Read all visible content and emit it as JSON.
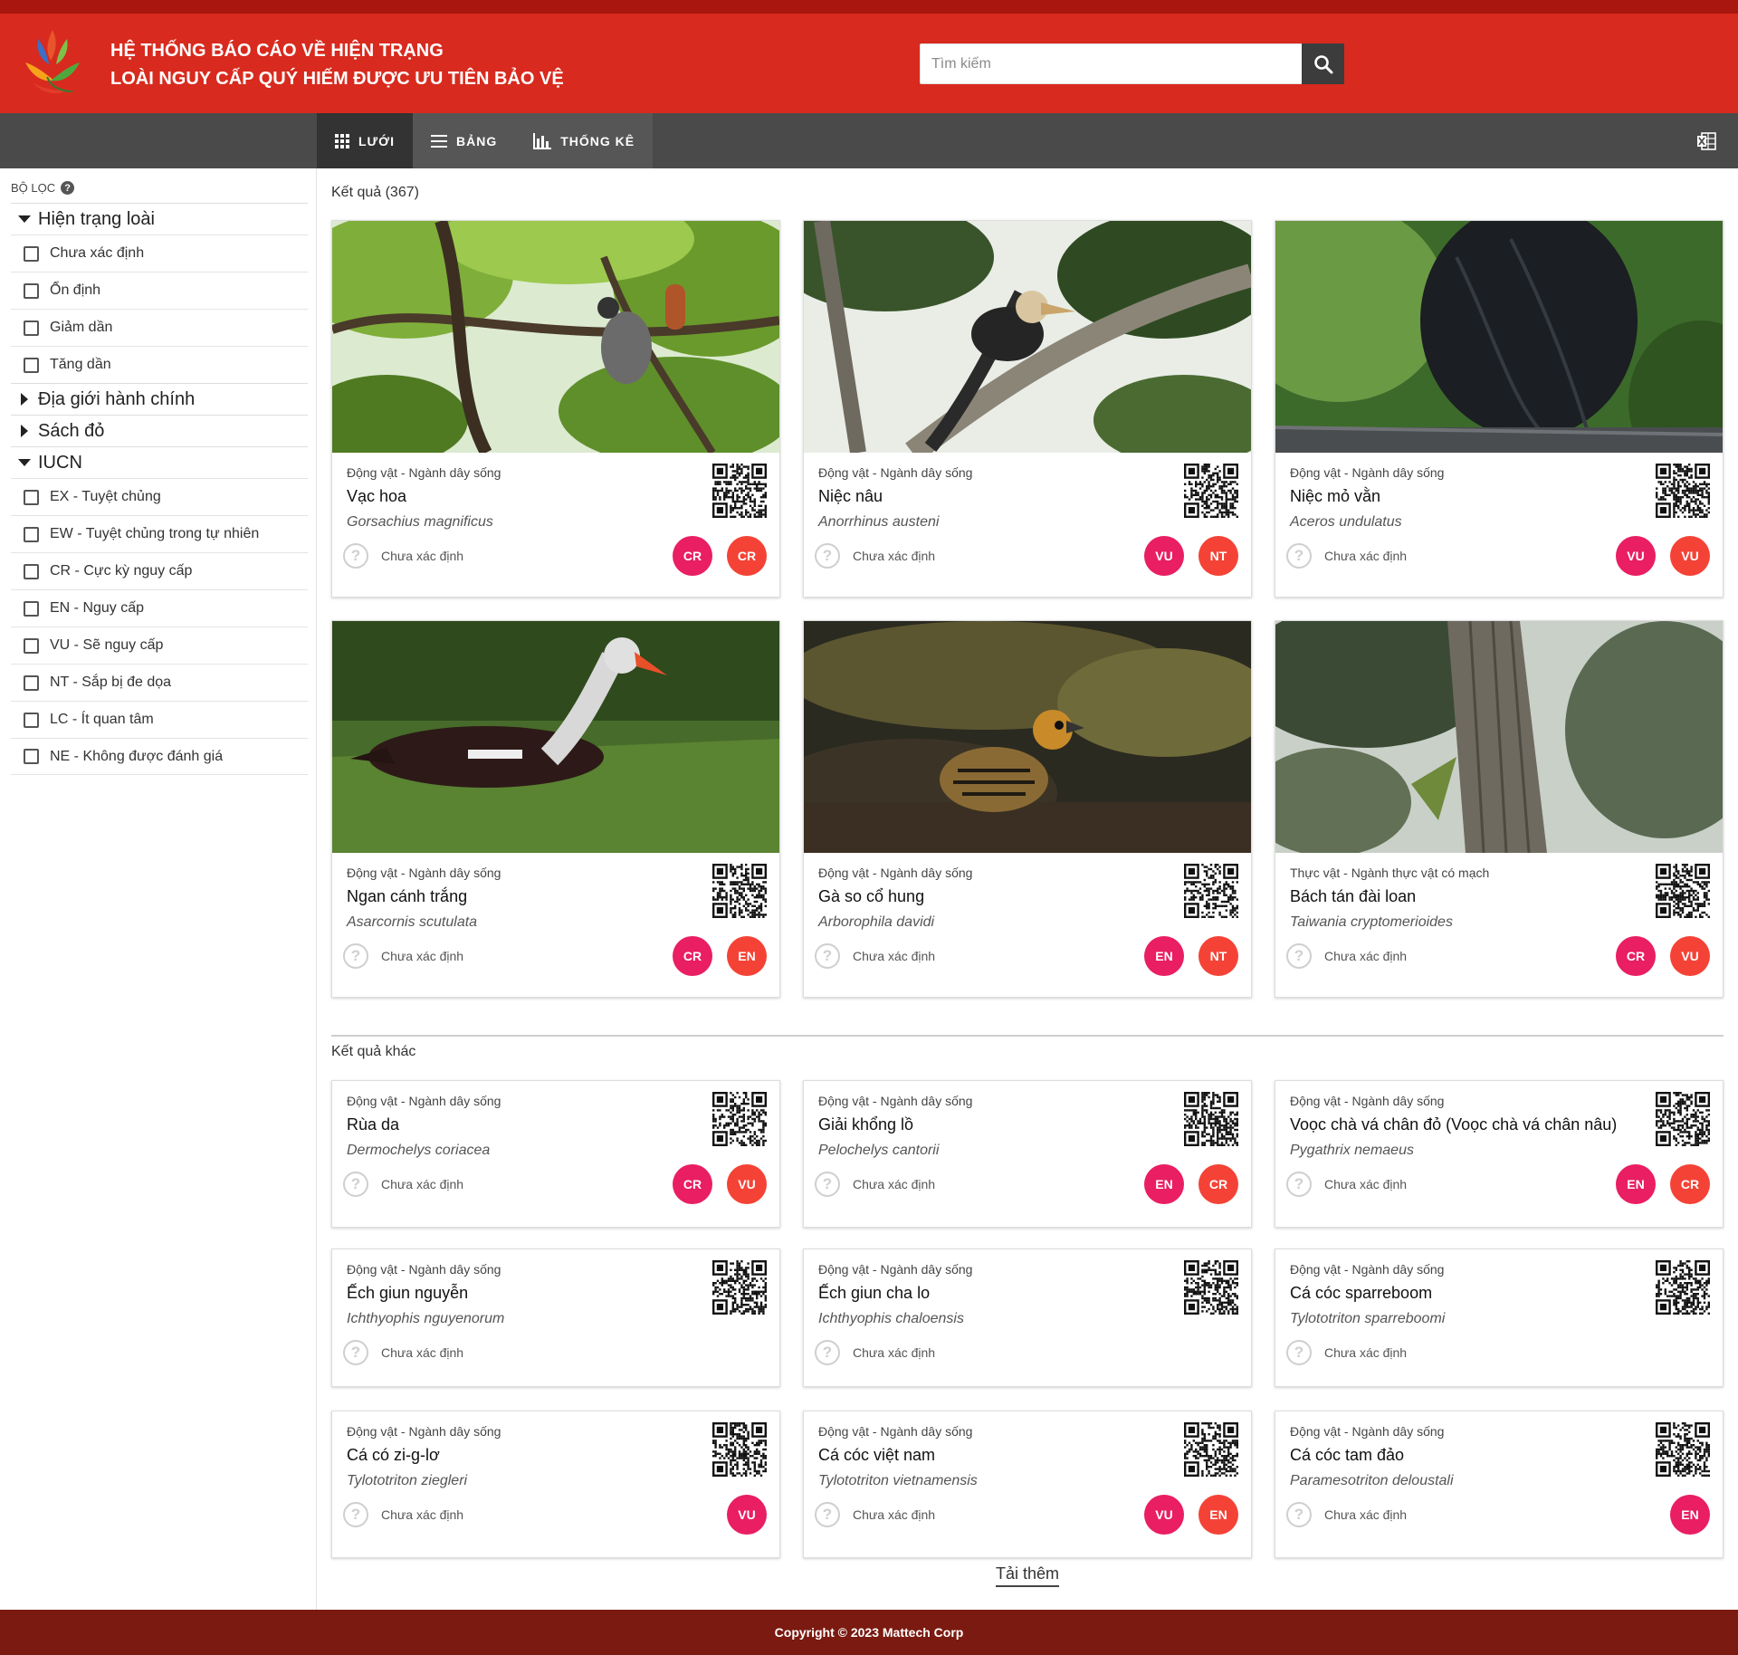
{
  "header": {
    "title_line1": "HỆ THỐNG BÁO CÁO VỀ HIỆN TRẠNG",
    "title_line2": "LOÀI NGUY CẤP QUÝ HIẾM ĐƯỢC ƯU TIÊN BẢO VỆ",
    "search_placeholder": "Tìm kiếm",
    "search_icon": "search-icon"
  },
  "toolbar": {
    "tabs": [
      {
        "label": "LƯỚI",
        "icon": "grid-icon",
        "active": true
      },
      {
        "label": "BẢNG",
        "icon": "list-icon",
        "active": false
      },
      {
        "label": "THỐNG KÊ",
        "icon": "bar-chart-icon",
        "active": false
      }
    ],
    "excel_icon": "excel-export-icon"
  },
  "sidebar": {
    "filter_label": "BỘ LỌC",
    "sections": [
      {
        "title": "Hiện trạng loài",
        "expanded": true,
        "options": [
          "Chưa xác định",
          "Ổn định",
          "Giảm dần",
          "Tăng dần"
        ]
      },
      {
        "title": "Địa giới hành chính",
        "expanded": false,
        "options": []
      },
      {
        "title": "Sách đỏ",
        "expanded": false,
        "options": []
      },
      {
        "title": "IUCN",
        "expanded": true,
        "options": [
          "EX - Tuyệt chủng",
          "EW - Tuyệt chủng trong tự nhiên",
          "CR - Cực kỳ nguy cấp",
          "EN - Nguy cấp",
          "VU - Sẽ nguy cấp",
          "NT - Sắp bị đe dọa",
          "LC - Ít quan tâm",
          "NE - Không được đánh giá"
        ]
      }
    ]
  },
  "main": {
    "results_label": "Kết quả (367)",
    "other_label": "Kết quả khác",
    "load_more": "Tải thêm",
    "colors": {
      "badge_primary": "#e91e63",
      "badge_secondary": "#f44336",
      "header_red": "#d82a1e"
    },
    "results": [
      {
        "kingdom": "Động vật - Ngành dây sống",
        "name": "Vạc hoa",
        "scientific": "Gorsachius magnificus",
        "status": "Chưa xác định",
        "badges": [
          "CR",
          "CR"
        ],
        "photo": "bird-on-branch-photo"
      },
      {
        "kingdom": "Động vật - Ngành dây sống",
        "name": "Niệc nâu",
        "scientific": "Anorrhinus austeni",
        "status": "Chưa xác định",
        "badges": [
          "VU",
          "NT"
        ],
        "photo": "hornbill-photo"
      },
      {
        "kingdom": "Động vật - Ngành dây sống",
        "name": "Niệc mỏ vằn",
        "scientific": "Aceros undulatus",
        "status": "Chưa xác định",
        "badges": [
          "VU",
          "VU"
        ],
        "photo": "black-hornbill-photo"
      },
      {
        "kingdom": "Động vật - Ngành dây sống",
        "name": "Ngan cánh trắng",
        "scientific": "Asarcornis scutulata",
        "status": "Chưa xác định",
        "badges": [
          "CR",
          "EN"
        ],
        "photo": "duck-on-grass-photo"
      },
      {
        "kingdom": "Động vật - Ngành dây sống",
        "name": "Gà so cổ hung",
        "scientific": "Arborophila davidi",
        "status": "Chưa xác định",
        "badges": [
          "EN",
          "NT"
        ],
        "photo": "partridge-photo"
      },
      {
        "kingdom": "Thực vật - Ngành thực vật có mạch",
        "name": "Bách tán đài loan",
        "scientific": "Taiwania cryptomerioides",
        "status": "Chưa xác định",
        "badges": [
          "CR",
          "VU"
        ],
        "photo": "tree-trunk-photo"
      }
    ],
    "others": [
      {
        "kingdom": "Động vật - Ngành dây sống",
        "name": "Rùa da",
        "scientific": "Dermochelys coriacea",
        "status": "Chưa xác định",
        "badges": [
          "CR",
          "VU"
        ]
      },
      {
        "kingdom": "Động vật - Ngành dây sống",
        "name": "Giải khổng lồ",
        "scientific": "Pelochelys cantorii",
        "status": "Chưa xác định",
        "badges": [
          "EN",
          "CR"
        ]
      },
      {
        "kingdom": "Động vật - Ngành dây sống",
        "name": "Voọc chà vá chân đỏ (Voọc chà vá chân nâu)",
        "scientific": "Pygathrix nemaeus",
        "status": "Chưa xác định",
        "badges": [
          "EN",
          "CR"
        ]
      },
      {
        "kingdom": "Động vật - Ngành dây sống",
        "name": "Ếch giun nguyễn",
        "scientific": "Ichthyophis nguyenorum",
        "status": "Chưa xác định",
        "badges": []
      },
      {
        "kingdom": "Động vật - Ngành dây sống",
        "name": "Ếch giun cha lo",
        "scientific": "Ichthyophis chaloensis",
        "status": "Chưa xác định",
        "badges": []
      },
      {
        "kingdom": "Động vật - Ngành dây sống",
        "name": "Cá cóc sparreboom",
        "scientific": "Tylototriton sparreboomi",
        "status": "Chưa xác định",
        "badges": []
      },
      {
        "kingdom": "Động vật - Ngành dây sống",
        "name": "Cá có zi-g-lơ",
        "scientific": "Tylototriton ziegleri",
        "status": "Chưa xác định",
        "badges": [
          "VU"
        ]
      },
      {
        "kingdom": "Động vật - Ngành dây sống",
        "name": "Cá cóc việt nam",
        "scientific": "Tylototriton vietnamensis",
        "status": "Chưa xác định",
        "badges": [
          "VU",
          "EN"
        ]
      },
      {
        "kingdom": "Động vật - Ngành dây sống",
        "name": "Cá cóc tam đảo",
        "scientific": "Paramesotriton deloustali",
        "status": "Chưa xác định",
        "badges": [
          "EN"
        ]
      }
    ]
  },
  "footer": {
    "copyright": "Copyright © 2023 Mattech Corp"
  }
}
